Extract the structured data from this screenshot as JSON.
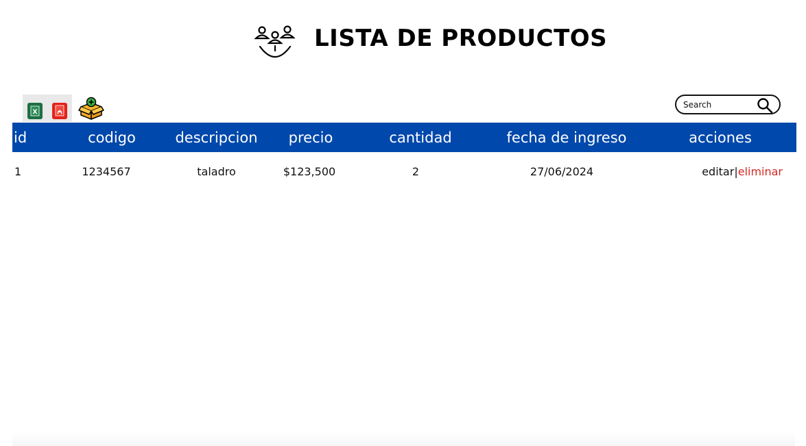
{
  "header": {
    "title": "LISTA DE PRODUCTOS",
    "icon": "team-group-icon"
  },
  "toolbar": {
    "export_excel_icon": "excel-icon",
    "export_pdf_icon": "pdf-icon",
    "add_product_icon": "add-box-icon",
    "excel_color": "#1d6f42",
    "pdf_color": "#e2231a"
  },
  "search": {
    "placeholder": "Search",
    "value": "",
    "icon": "search-icon"
  },
  "table": {
    "header_color": "#0048ab",
    "columns": [
      "id",
      "codigo",
      "descripcion",
      "precio",
      "cantidad",
      "fecha de ingreso",
      "acciones"
    ],
    "rows": [
      {
        "id": "1",
        "codigo": "1234567",
        "descripcion": "taladro",
        "precio": "$123,500",
        "cantidad": "2",
        "fecha_ingreso": "27/06/2024",
        "edit_label": "editar",
        "separator": "|",
        "delete_label": "eliminar"
      }
    ]
  },
  "colors": {
    "delete_link": "#d42a24"
  }
}
